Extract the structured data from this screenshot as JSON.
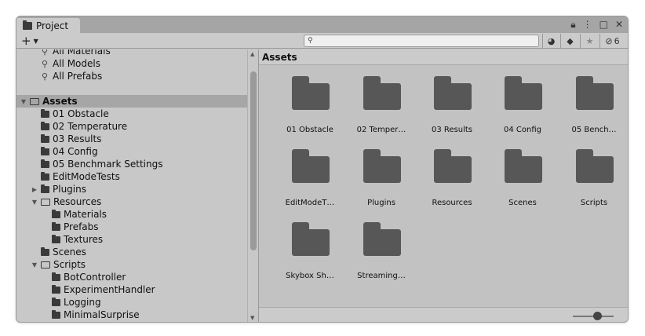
{
  "window": {
    "tab_title": "Project",
    "controls": [
      "lock-icon",
      "menu-icon",
      "maximize-icon",
      "close-icon"
    ]
  },
  "toolbar": {
    "add_label": "+",
    "search_placeholder": "",
    "hidden_count": "6"
  },
  "tree": {
    "favorites": [
      "All Materials",
      "All Models",
      "All Prefabs"
    ],
    "assets_root": "Assets",
    "items": [
      {
        "label": "01 Obstacle",
        "depth": 1,
        "expanded": null
      },
      {
        "label": "02 Temperature",
        "depth": 1,
        "expanded": null
      },
      {
        "label": "03 Results",
        "depth": 1,
        "expanded": null
      },
      {
        "label": "04 Config",
        "depth": 1,
        "expanded": null
      },
      {
        "label": "05 Benchmark Settings",
        "depth": 1,
        "expanded": null
      },
      {
        "label": "EditModeTests",
        "depth": 1,
        "expanded": null
      },
      {
        "label": "Plugins",
        "depth": 1,
        "expanded": false
      },
      {
        "label": "Resources",
        "depth": 1,
        "expanded": true
      },
      {
        "label": "Materials",
        "depth": 2,
        "expanded": null
      },
      {
        "label": "Prefabs",
        "depth": 2,
        "expanded": null
      },
      {
        "label": "Textures",
        "depth": 2,
        "expanded": null
      },
      {
        "label": "Scenes",
        "depth": 1,
        "expanded": null
      },
      {
        "label": "Scripts",
        "depth": 1,
        "expanded": true
      },
      {
        "label": "BotController",
        "depth": 2,
        "expanded": null
      },
      {
        "label": "ExperimentHandler",
        "depth": 2,
        "expanded": null
      },
      {
        "label": "Logging",
        "depth": 2,
        "expanded": null
      },
      {
        "label": "MinimalSurprise",
        "depth": 2,
        "expanded": null
      }
    ]
  },
  "main": {
    "breadcrumb": "Assets",
    "tiles": [
      "01 Obstacle",
      "02 Temper…",
      "03 Results",
      "04 Config",
      "05 Bench…",
      "EditModeT…",
      "Plugins",
      "Resources",
      "Scenes",
      "Scripts",
      "Skybox Sh…",
      "Streaming…"
    ],
    "zoom_level": 0.6
  }
}
